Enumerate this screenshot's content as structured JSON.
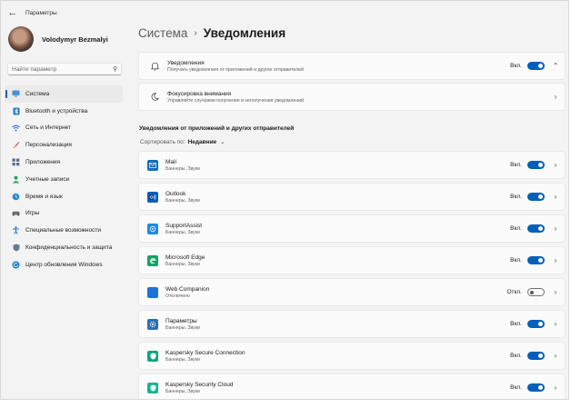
{
  "window": {
    "title": "Параметры",
    "back_glyph": "←"
  },
  "profile": {
    "name": "Volodymyr Bezmalyi"
  },
  "search": {
    "placeholder": "Найти параметр",
    "icon": "search-icon"
  },
  "sidebar": {
    "active_color": "#005fb8",
    "items": [
      {
        "label": "Система",
        "icon": "monitor-icon",
        "active": true
      },
      {
        "label": "Bluetooth и устройства",
        "icon": "bluetooth-icon"
      },
      {
        "label": "Сеть и Интернет",
        "icon": "wifi-icon"
      },
      {
        "label": "Персонализация",
        "icon": "brush-icon"
      },
      {
        "label": "Приложения",
        "icon": "apps-icon"
      },
      {
        "label": "Учетные записи",
        "icon": "person-icon"
      },
      {
        "label": "Время и язык",
        "icon": "globe-clock-icon"
      },
      {
        "label": "Игры",
        "icon": "gamepad-icon"
      },
      {
        "label": "Специальные возможности",
        "icon": "accessibility-icon"
      },
      {
        "label": "Конфиденциальность и защита",
        "icon": "shield-icon"
      },
      {
        "label": "Центр обновления Windows",
        "icon": "update-icon"
      }
    ]
  },
  "breadcrumb": {
    "parent": "Система",
    "separator": "›",
    "current": "Уведомления"
  },
  "top_cards": {
    "notifications": {
      "title": "Уведомления",
      "subtitle": "Получать уведомления от приложений и других отправителей",
      "state": "Вкл.",
      "on": true,
      "icon": "bell-icon",
      "chevron": "⌃"
    },
    "focus": {
      "title": "Фокусировка внимания",
      "subtitle": "Управляйте случаями получения и неполучения уведомлений",
      "icon": "moon-icon",
      "chevron": "›"
    }
  },
  "apps_section": {
    "title": "Уведомления от приложений и других отправителей",
    "sort_label": "Сортировать по:",
    "sort_value": "Недавние",
    "sort_chevron": "⌄",
    "row_chevron": "›",
    "apps": [
      {
        "name": "Mail",
        "sub": "Баннеры, Звуки",
        "state": "Вкл.",
        "on": true,
        "icon": "mail-icon",
        "color": "#0f6cbd"
      },
      {
        "name": "Outlook",
        "sub": "Баннеры, Звуки",
        "state": "Вкл.",
        "on": true,
        "icon": "outlook-icon",
        "color": "#0a5fb4"
      },
      {
        "name": "SupportAssist",
        "sub": "Баннеры, Звуки",
        "state": "Вкл.",
        "on": true,
        "icon": "supportassist-icon",
        "color": "#1e88e5"
      },
      {
        "name": "Microsoft Edge",
        "sub": "Баннеры, Звуки",
        "state": "Вкл.",
        "on": true,
        "icon": "edge-icon",
        "color": "#1a9e6a"
      },
      {
        "name": "Web Companion",
        "sub": "Отключено",
        "state": "Откл.",
        "on": false,
        "icon": "web-companion-icon",
        "color": "#1a73d9"
      },
      {
        "name": "Параметры",
        "sub": "Баннеры, Звуки",
        "state": "Вкл.",
        "on": true,
        "icon": "settings-gear-icon",
        "color": "#2b6fb5"
      },
      {
        "name": "Kaspersky Secure Connection",
        "sub": "Баннеры, Звуки",
        "state": "Вкл.",
        "on": true,
        "icon": "kaspersky-vpn-icon",
        "color": "#15a37e"
      },
      {
        "name": "Kaspersky Security Cloud",
        "sub": "Баннеры, Звуки",
        "state": "Вкл.",
        "on": true,
        "icon": "kaspersky-cloud-icon",
        "color": "#1bb394"
      }
    ]
  }
}
